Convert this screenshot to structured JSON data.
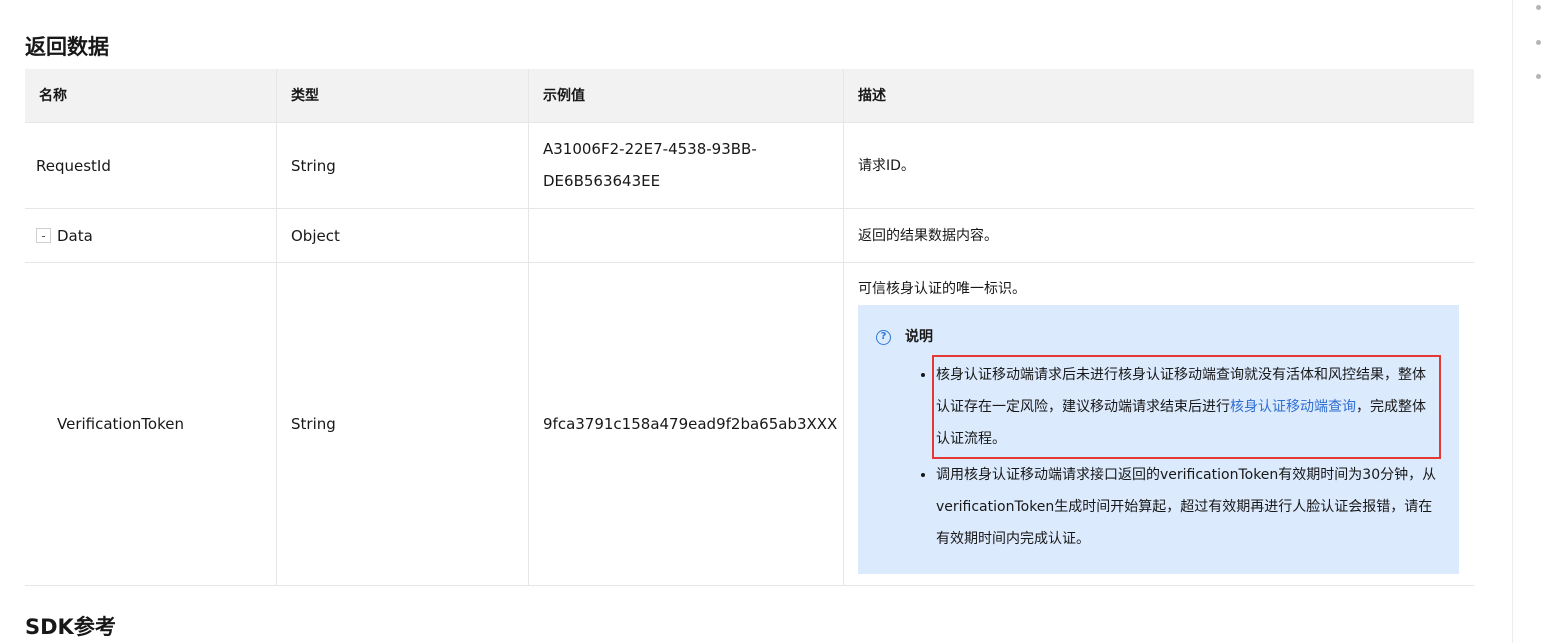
{
  "sections": {
    "return_data_title": "返回数据",
    "sdk_title": "SDK参考"
  },
  "table": {
    "headers": [
      "名称",
      "类型",
      "示例值",
      "描述"
    ],
    "rows": [
      {
        "name": "RequestId",
        "type": "String",
        "example_line1": "A31006F2-22E7-4538-93BB-",
        "example_line2": "DE6B563643EE",
        "description": "请求ID。"
      },
      {
        "toggle": "-",
        "name": "Data",
        "type": "Object",
        "example": "",
        "description": "返回的结果数据内容。"
      },
      {
        "name": "VerificationToken",
        "type": "String",
        "example": "9fca3791c158a479ead9f2ba65ab3XXX",
        "description": "可信核身认证的唯一标识。",
        "note": {
          "title": "说明",
          "item1_text": "核身认证移动端请求后未进行核身认证移动端查询就没有活体和风控结果，整体认证存在一定风险，建议移动端请求结束后进行",
          "item1_link": "核身认证移动端查询",
          "item1_tail": "，完成整体认证流程。",
          "item2_text": "调用核身认证移动端请求接口返回的verificationToken有效期时间为30分钟，从verificationToken生成时间开始算起，超过有效期再进行人脸认证会报错，请在有效期时间内完成认证。"
        }
      }
    ]
  },
  "colors": {
    "header_bg": "#f2f2f2",
    "note_bg": "#dceafd",
    "link": "#2f6fd1",
    "highlight_border": "#e53935"
  },
  "icons": {
    "note_icon": "question-circle-icon",
    "toggle_icon": "collapse-minus-icon"
  }
}
